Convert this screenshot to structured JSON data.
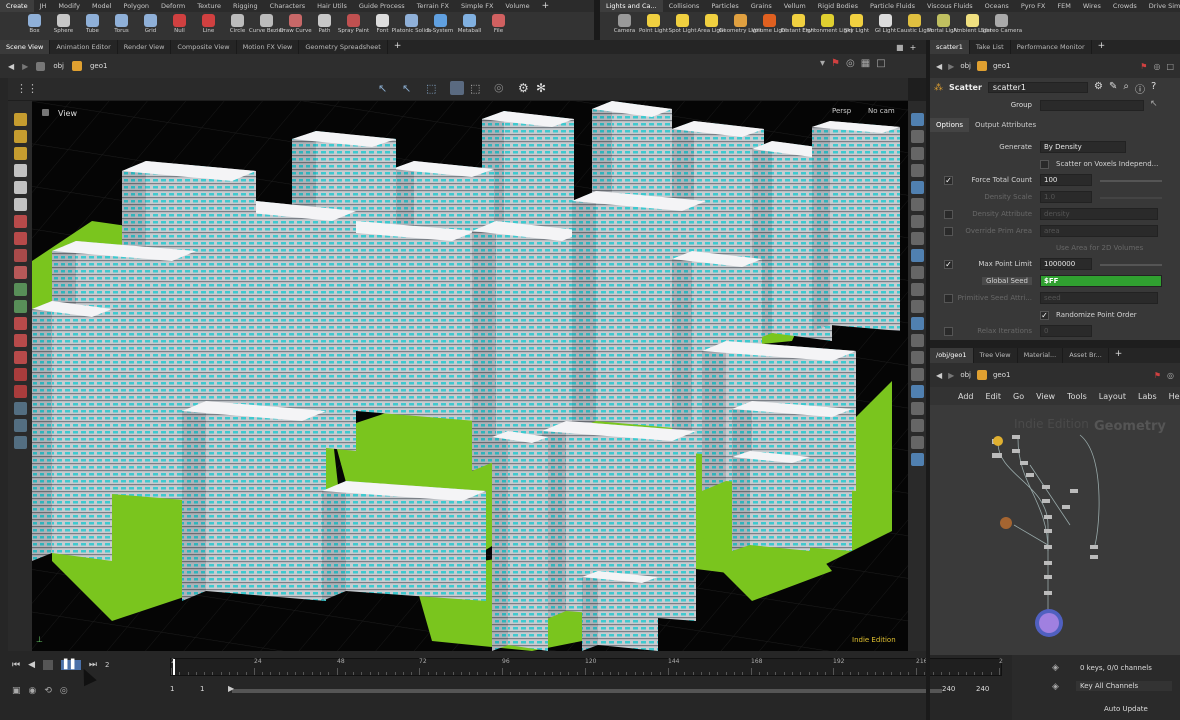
{
  "shelf_left": {
    "tabs": [
      "Create",
      "JH",
      "Modify",
      "Model",
      "Polygon",
      "Deform",
      "Texture",
      "Rigging",
      "Characters",
      "Hair Utils",
      "Guide Process",
      "Terrain FX",
      "Simple FX",
      "Volume"
    ],
    "active_tab": 0,
    "tools": [
      {
        "label": "Box",
        "icon": "box-icon",
        "color": "#8fb0d8"
      },
      {
        "label": "Sphere",
        "icon": "sphere-icon",
        "color": "#c8c8c8"
      },
      {
        "label": "Tube",
        "icon": "tube-icon",
        "color": "#8fb0d8"
      },
      {
        "label": "Torus",
        "icon": "torus-icon",
        "color": "#8fb0d8"
      },
      {
        "label": "Grid",
        "icon": "grid-icon",
        "color": "#8fb0d8"
      },
      {
        "label": "Null",
        "icon": "null-icon",
        "color": "#d04040"
      },
      {
        "label": "Line",
        "icon": "line-icon",
        "color": "#d04040"
      },
      {
        "label": "Circle",
        "icon": "circle-icon",
        "color": "#bbbbbb"
      },
      {
        "label": "Curve Bezier",
        "icon": "curve-bezier-icon",
        "color": "#bbbbbb"
      },
      {
        "label": "Draw Curve",
        "icon": "draw-curve-icon",
        "color": "#c86868"
      },
      {
        "label": "Path",
        "icon": "path-icon",
        "color": "#c8c8c8"
      },
      {
        "label": "Spray Paint",
        "icon": "spray-paint-icon",
        "color": "#c05050"
      },
      {
        "label": "Font",
        "icon": "font-icon",
        "color": "#dddddd"
      },
      {
        "label": "Platonic Solids",
        "icon": "platonic-solids-icon",
        "color": "#8fb0d8"
      },
      {
        "label": "L-System",
        "icon": "l-system-icon",
        "color": "#60a0e0"
      },
      {
        "label": "Metaball",
        "icon": "metaball-icon",
        "color": "#80b0e0"
      },
      {
        "label": "File",
        "icon": "file-icon",
        "color": "#d06060"
      }
    ]
  },
  "shelf_right": {
    "tabs": [
      "Lights and Ca...",
      "Collisions",
      "Particles",
      "Grains",
      "Vellum",
      "Rigid Bodies",
      "Particle Fluids",
      "Viscous Fluids",
      "Oceans",
      "Pyro FX",
      "FEM",
      "Wires",
      "Crowds",
      "Drive Simulati..."
    ],
    "active_tab": 0,
    "tools": [
      {
        "label": "Camera",
        "icon": "camera-icon",
        "color": "#999999"
      },
      {
        "label": "Point Light",
        "icon": "point-light-icon",
        "color": "#f0d040"
      },
      {
        "label": "Spot Light",
        "icon": "spot-light-icon",
        "color": "#f0d040"
      },
      {
        "label": "Area Light",
        "icon": "area-light-icon",
        "color": "#f0d040"
      },
      {
        "label": "Geometry Light",
        "icon": "geometry-light-icon",
        "color": "#e0a040"
      },
      {
        "label": "Volume Light",
        "icon": "volume-light-icon",
        "color": "#e06020"
      },
      {
        "label": "Distant Light",
        "icon": "distant-light-icon",
        "color": "#f0d040"
      },
      {
        "label": "Environment Light",
        "icon": "environment-light-icon",
        "color": "#e0d030"
      },
      {
        "label": "Sky Light",
        "icon": "sky-light-icon",
        "color": "#f0d040"
      },
      {
        "label": "GI Light",
        "icon": "gi-light-icon",
        "color": "#dddddd"
      },
      {
        "label": "Caustic Light",
        "icon": "caustic-light-icon",
        "color": "#e0c040"
      },
      {
        "label": "Portal Light",
        "icon": "portal-light-icon",
        "color": "#c0c060"
      },
      {
        "label": "Ambient Light",
        "icon": "ambient-light-icon",
        "color": "#f0e080"
      },
      {
        "label": "Stereo Camera",
        "icon": "stereo-camera-icon",
        "color": "#aaaaaa"
      }
    ]
  },
  "pane_tabs_left": [
    "Scene View",
    "Animation Editor",
    "Render View",
    "Composite View",
    "Motion FX View",
    "Geometry Spreadsheet"
  ],
  "path_left": {
    "context": "obj",
    "node": "geo1"
  },
  "viewport": {
    "label": "View",
    "persp": "Persp",
    "cam": "No cam",
    "watermark": "Indie Edition"
  },
  "pane_tabs_right": [
    "scatter1",
    "Take List",
    "Performance Monitor"
  ],
  "path_right": {
    "context": "obj",
    "node": "geo1"
  },
  "params": {
    "node_type": "Scatter",
    "node_name": "scatter1",
    "group_label": "Group",
    "tabs": [
      "Options",
      "Output Attributes"
    ],
    "generate_label": "Generate",
    "generate_value": "By Density",
    "scatter_voxels": "Scatter on Voxels Independ...",
    "force_total_label": "Force Total Count",
    "force_total_value": "100",
    "density_scale_label": "Density Scale",
    "density_scale_value": "1.0",
    "density_attr_label": "Density Attribute",
    "density_attr_value": "density",
    "override_prim_label": "Override Prim Area",
    "override_prim_value": "area",
    "use_area": "Use Area for 2D Volumes",
    "max_point_label": "Max Point Limit",
    "max_point_value": "1000000",
    "global_seed_label": "Global Seed",
    "global_seed_value": "$FF",
    "prim_seed_label": "Primitive Seed Attri...",
    "prim_seed_value": "seed",
    "randomize": "Randomize Point Order",
    "relax_label": "Relax Iterations",
    "relax_value": "0"
  },
  "net_tabs": [
    "/obj/geo1",
    "Tree View",
    "Material...",
    "Asset Br..."
  ],
  "net_path": {
    "context": "obj",
    "node": "geo1"
  },
  "net_menu": [
    "Add",
    "Edit",
    "Go",
    "View",
    "Tools",
    "Layout",
    "Labs",
    "Help"
  ],
  "network": {
    "watermark": "Indie Edition",
    "context_label": "Geometry"
  },
  "timeline": {
    "ticks": [
      "2",
      "24",
      "48",
      "72",
      "96",
      "120",
      "144",
      "168",
      "192",
      "216",
      "2"
    ],
    "current_frame": "2",
    "start": "1",
    "start2": "1",
    "end": "240",
    "end2": "240"
  },
  "status": {
    "keys": "0 keys, 0/0 channels",
    "key_all": "Key All Channels",
    "auto_update": "Auto Update"
  }
}
